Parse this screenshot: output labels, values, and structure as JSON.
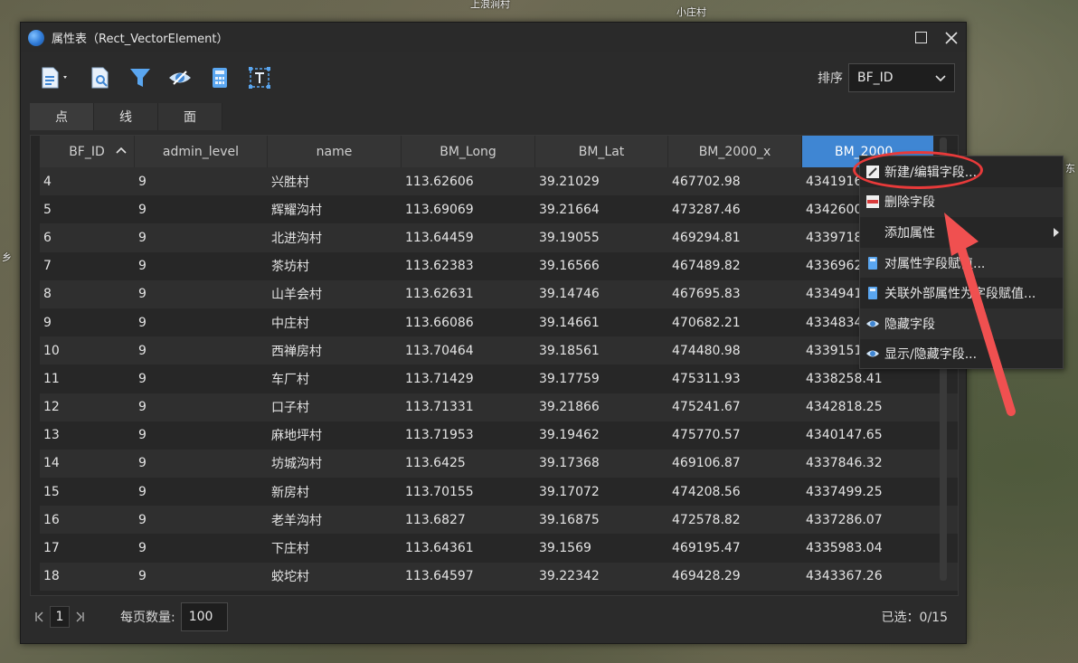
{
  "map": {
    "labels": [
      "上浪涧村",
      "小庄村",
      "东",
      "乡"
    ]
  },
  "window": {
    "title": "属性表（Rect_VectorElement）"
  },
  "toolbar": {
    "sort_label": "排序",
    "sort_value": "BF_ID",
    "tools": [
      {
        "name": "export-icon"
      },
      {
        "name": "zoom-to-feature-icon"
      },
      {
        "name": "filter-icon"
      },
      {
        "name": "eye-icon"
      },
      {
        "name": "calculator-icon"
      },
      {
        "name": "text-field-icon"
      }
    ]
  },
  "tabs": [
    "点",
    "线",
    "面"
  ],
  "table": {
    "columns": [
      "BF_ID",
      "admin_level",
      "name",
      "BM_Long",
      "BM_Lat",
      "BM_2000_x",
      "BM_2000"
    ],
    "rows": [
      [
        "4",
        "9",
        "兴胜村",
        "113.62606",
        "39.21029",
        "467702.98",
        "4341916.…"
      ],
      [
        "5",
        "9",
        "辉耀沟村",
        "113.69069",
        "39.21664",
        "473287.46",
        "4342600.…"
      ],
      [
        "6",
        "9",
        "北进沟村",
        "113.64459",
        "39.19055",
        "469294.81",
        "4339718.…"
      ],
      [
        "7",
        "9",
        "茶坊村",
        "113.62383",
        "39.16566",
        "467489.82",
        "4336962.…"
      ],
      [
        "8",
        "9",
        "山羊会村",
        "113.62631",
        "39.14746",
        "467695.83",
        "4334941.…"
      ],
      [
        "9",
        "9",
        "中庄村",
        "113.66086",
        "39.14661",
        "470682.21",
        "4334834.…"
      ],
      [
        "10",
        "9",
        "西禅房村",
        "113.70464",
        "39.18561",
        "474480.98",
        "4339151.…"
      ],
      [
        "11",
        "9",
        "车厂村",
        "113.71429",
        "39.17759",
        "475311.93",
        "4338258.41"
      ],
      [
        "12",
        "9",
        "口子村",
        "113.71331",
        "39.21866",
        "475241.67",
        "4342818.25"
      ],
      [
        "13",
        "9",
        "麻地坪村",
        "113.71953",
        "39.19462",
        "475770.57",
        "4340147.65"
      ],
      [
        "14",
        "9",
        "坊城沟村",
        "113.6425",
        "39.17368",
        "469106.87",
        "4337846.32"
      ],
      [
        "15",
        "9",
        "新房村",
        "113.70155",
        "39.17072",
        "474208.56",
        "4337499.25"
      ],
      [
        "16",
        "9",
        "老羊沟村",
        "113.6827",
        "39.16875",
        "472578.82",
        "4337286.07"
      ],
      [
        "17",
        "9",
        "下庄村",
        "113.64361",
        "39.1569",
        "469195.47",
        "4335983.04"
      ],
      [
        "18",
        "9",
        "蛟坨村",
        "113.64597",
        "39.22342",
        "469428.29",
        "4343367.26"
      ]
    ]
  },
  "footer": {
    "page": "1",
    "per_page_label": "每页数量:",
    "per_page_value": "100",
    "selected": "已选：0/15"
  },
  "context_menu": {
    "items": [
      {
        "label": "新建/编辑字段...",
        "icon": "edit-field-icon"
      },
      {
        "label": "删除字段",
        "icon": "delete-field-icon"
      },
      {
        "label": "添加属性",
        "icon": ""
      },
      {
        "label": "对属性字段赋值...",
        "icon": "assign-value-icon"
      },
      {
        "label": "关联外部属性为字段赋值...",
        "icon": "join-attribute-icon"
      },
      {
        "label": "隐藏字段",
        "icon": "hide-eye-icon"
      },
      {
        "label": "显示/隐藏字段...",
        "icon": "show-hide-eye-icon"
      }
    ]
  },
  "colors": {
    "accent": "#3f86d3",
    "annotation": "#e83a3a"
  }
}
